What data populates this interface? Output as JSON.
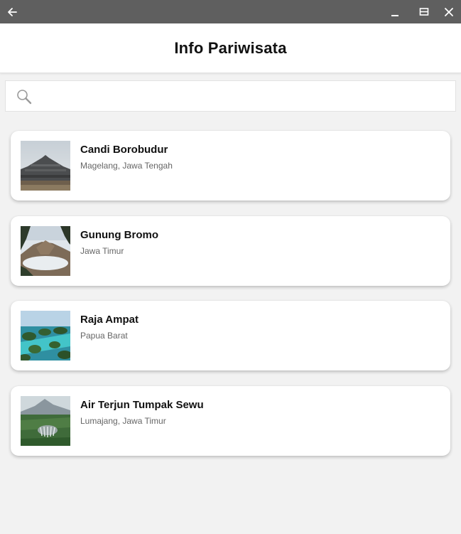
{
  "window": {
    "back_icon": "arrow-left-icon",
    "minimize_icon": "minimize-icon",
    "maximize_icon": "maximize-icon",
    "close_icon": "close-icon",
    "bar_color": "#5f5f5f"
  },
  "appbar": {
    "title": "Info Pariwisata"
  },
  "search": {
    "icon": "search-icon",
    "value": "",
    "placeholder": ""
  },
  "destinations": [
    {
      "name": "Candi Borobudur",
      "location": "Magelang, Jawa Tengah",
      "image": "temple-photo"
    },
    {
      "name": "Gunung Bromo",
      "location": "Jawa Timur",
      "image": "volcano-photo"
    },
    {
      "name": "Raja Ampat",
      "location": "Papua Barat",
      "image": "islands-photo"
    },
    {
      "name": "Air Terjun Tumpak Sewu",
      "location": "Lumajang, Jawa Timur",
      "image": "waterfall-photo"
    }
  ]
}
